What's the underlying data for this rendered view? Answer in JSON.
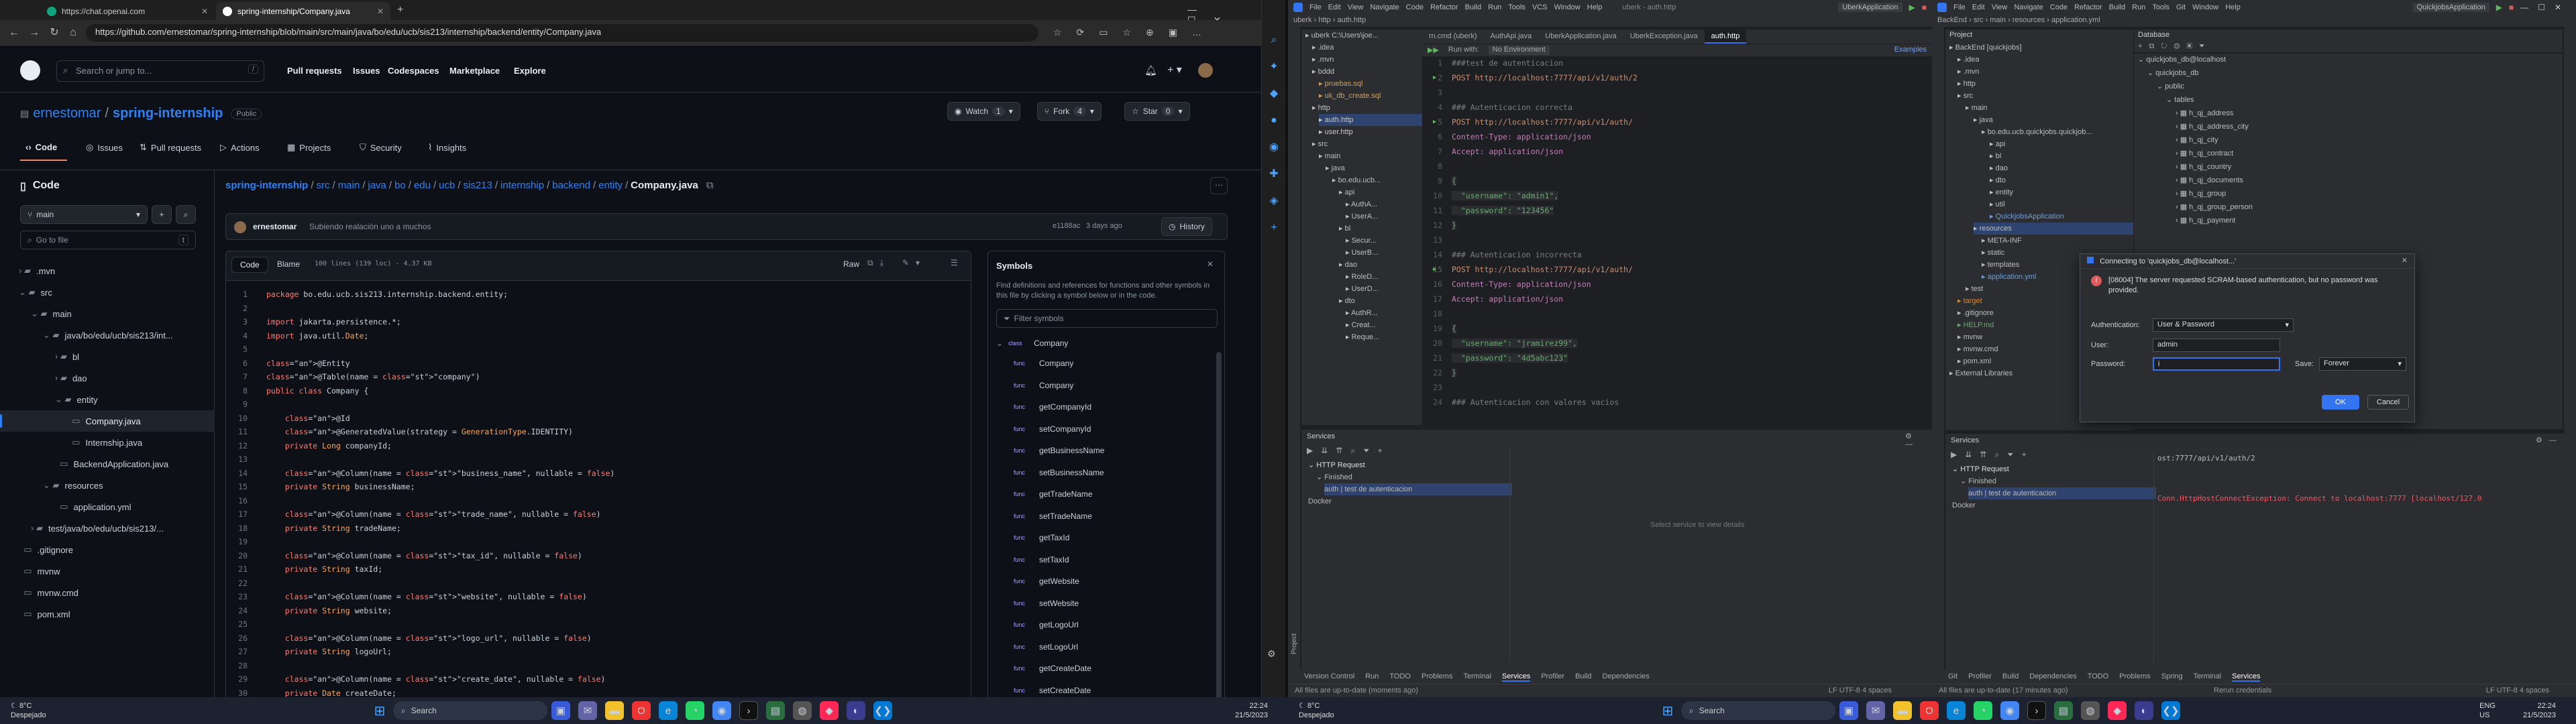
{
  "browser": {
    "tabs": [
      {
        "title": "https://chat.openai.com"
      },
      {
        "title": "spring-internship/Company.java"
      }
    ],
    "url": "https://github.com/ernestomar/spring-internship/blob/main/src/main/java/bo/edu/ucb/sis213/internship/backend/entity/Company.java"
  },
  "github": {
    "search_placeholder": "Search or jump to...",
    "search_key": "/",
    "nav": [
      "Pull requests",
      "Issues",
      "Codespaces",
      "Marketplace",
      "Explore"
    ],
    "owner": "ernestomar",
    "repo": "spring-internship",
    "visibility": "Public",
    "watch": {
      "label": "Watch",
      "count": "1"
    },
    "fork": {
      "label": "Fork",
      "count": "4"
    },
    "star": {
      "label": "Star",
      "count": "0"
    },
    "repo_tabs": [
      "Code",
      "Issues",
      "Pull requests",
      "Actions",
      "Projects",
      "Security",
      "Insights"
    ]
  },
  "tree": {
    "title": "Code",
    "branch": "main",
    "filter_placeholder": "Go to file",
    "filter_key": "t",
    "items": [
      {
        "label": ".mvn",
        "indent": 0,
        "type": "folder"
      },
      {
        "label": "src",
        "indent": 0,
        "type": "folder-open"
      },
      {
        "label": "main",
        "indent": 1,
        "type": "folder-open"
      },
      {
        "label": "java/bo/edu/ucb/sis213/int...",
        "indent": 2,
        "type": "folder-open"
      },
      {
        "label": "bl",
        "indent": 3,
        "type": "folder"
      },
      {
        "label": "dao",
        "indent": 3,
        "type": "folder"
      },
      {
        "label": "entity",
        "indent": 3,
        "type": "folder-open"
      },
      {
        "label": "Company.java",
        "indent": 4,
        "type": "file",
        "selected": true
      },
      {
        "label": "Internship.java",
        "indent": 4,
        "type": "file"
      },
      {
        "label": "BackendApplication.java",
        "indent": 3,
        "type": "file"
      },
      {
        "label": "resources",
        "indent": 2,
        "type": "folder-open"
      },
      {
        "label": "application.yml",
        "indent": 3,
        "type": "file"
      },
      {
        "label": "test/java/bo/edu/ucb/sis213/...",
        "indent": 1,
        "type": "folder"
      },
      {
        "label": ".gitignore",
        "indent": 0,
        "type": "file"
      },
      {
        "label": "mvnw",
        "indent": 0,
        "type": "file"
      },
      {
        "label": "mvnw.cmd",
        "indent": 0,
        "type": "file"
      },
      {
        "label": "pom.xml",
        "indent": 0,
        "type": "file"
      }
    ]
  },
  "breadcrumb": {
    "parts": [
      "spring-internship",
      "src",
      "main",
      "java",
      "bo",
      "edu",
      "ucb",
      "sis213",
      "internship",
      "backend",
      "entity"
    ],
    "file": "Company.java"
  },
  "commit": {
    "author": "ernestomar",
    "message": "Subiendo realación uno a muchos",
    "hash": "e1188ac",
    "time": "3 days ago",
    "history": "History"
  },
  "file_toolbar": {
    "code_tab": "Code",
    "blame_tab": "Blame",
    "stats": "100 lines (139 loc) · 4.37 KB",
    "raw": "Raw"
  },
  "code_lines": [
    "package bo.edu.ucb.sis213.internship.backend.entity;",
    "",
    "import jakarta.persistence.*;",
    "import java.util.Date;",
    "",
    "@Entity",
    "@Table(name = \"company\")",
    "public class Company {",
    "",
    "    @Id",
    "    @GeneratedValue(strategy = GenerationType.IDENTITY)",
    "    private Long companyId;",
    "",
    "    @Column(name = \"business_name\", nullable = false)",
    "    private String businessName;",
    "",
    "    @Column(name = \"trade_name\", nullable = false)",
    "    private String tradeName;",
    "",
    "    @Column(name = \"tax_id\", nullable = false)",
    "    private String taxId;",
    "",
    "    @Column(name = \"website\", nullable = false)",
    "    private String website;",
    "",
    "    @Column(name = \"logo_url\", nullable = false)",
    "    private String logoUrl;",
    "",
    "    @Column(name = \"create_date\", nullable = false)",
    "    private Date createDate;"
  ],
  "symbols": {
    "title": "Symbols",
    "description": "Find definitions and references for functions and other symbols in this file by clicking a symbol below or in the code.",
    "filter_placeholder": "Filter symbols",
    "class_badge": "class",
    "func_badge": "func",
    "root": "Company",
    "items": [
      "Company",
      "Company",
      "getCompanyId",
      "setCompanyId",
      "getBusinessName",
      "setBusinessName",
      "getTradeName",
      "setTradeName",
      "getTaxId",
      "setTaxId",
      "getWebsite",
      "setWebsite",
      "getLogoUrl",
      "setLogoUrl",
      "getCreateDate",
      "setCreateDate"
    ]
  },
  "ide1": {
    "title": "uberk - auth.http",
    "menu": [
      "File",
      "Edit",
      "View",
      "Navigate",
      "Code",
      "Refactor",
      "Build",
      "Run",
      "Tools",
      "VCS",
      "Window",
      "Help"
    ],
    "run_config": "UberkApplication",
    "breadcrumb": [
      "uberk",
      "http",
      "auth.http"
    ],
    "editor_tabs": [
      "rn.cmd (uberk)",
      "AuthApi.java",
      "UberkApplication.java",
      "UberkException.java",
      "auth.http"
    ],
    "run_with": "Run with:",
    "env": "No Environment",
    "examples": "Examples",
    "project_label": "Project",
    "project_tree": [
      "uberk C:\\Users\\joe...",
      ".idea",
      ".mvn",
      "bddd",
      "pruebas.sql",
      "uk_db_create.sql",
      "http",
      "auth.http",
      "user.http",
      "src",
      "main",
      "java",
      "bo.edu.ucb...",
      "api",
      "AuthA...",
      "UserA...",
      "bl",
      "Secur...",
      "UserB...",
      "dao",
      "RoleD...",
      "UserD...",
      "dto",
      "AuthR...",
      "Creat...",
      "Reque..."
    ],
    "editor_lines": [
      {
        "t": "###test de autenticacion",
        "c": "cm"
      },
      {
        "t": "POST http://localhost:7777/api/v1/auth/2",
        "c": "req"
      },
      {
        "t": "",
        "c": ""
      },
      {
        "t": "### Autenticacion correcta",
        "c": "cm"
      },
      {
        "t": "POST http://localhost:7777/api/v1/auth/",
        "c": "req"
      },
      {
        "t": "Content-Type: application/json",
        "c": "hd"
      },
      {
        "t": "Accept: application/json",
        "c": "hd"
      },
      {
        "t": "",
        "c": ""
      },
      {
        "t": "{",
        "c": "js"
      },
      {
        "t": "  \"username\": \"admin1\",",
        "c": "js"
      },
      {
        "t": "  \"password\": \"123456\"",
        "c": "js"
      },
      {
        "t": "}",
        "c": "js"
      },
      {
        "t": "",
        "c": ""
      },
      {
        "t": "### Autenticacion incorrecta",
        "c": "cm"
      },
      {
        "t": "POST http://localhost:7777/api/v1/auth/",
        "c": "req"
      },
      {
        "t": "Content-Type: application/json",
        "c": "hd"
      },
      {
        "t": "Accept: application/json",
        "c": "hd"
      },
      {
        "t": "",
        "c": ""
      },
      {
        "t": "{",
        "c": "js"
      },
      {
        "t": "  \"username\": \"jramirez99\",",
        "c": "js"
      },
      {
        "t": "  \"password\": \"4d5abc123\"",
        "c": "js"
      },
      {
        "t": "}",
        "c": "js"
      },
      {
        "t": "",
        "c": ""
      },
      {
        "t": "### Autenticacion con valores vacios",
        "c": "cm"
      }
    ],
    "services_title": "Services",
    "services_tree": [
      "HTTP Request",
      "Finished",
      "auth | test de autenticacion",
      "Docker"
    ],
    "services_hint": "Select service to view details",
    "bottom_tabs": [
      "Version Control",
      "Run",
      "TODO",
      "Problems",
      "Terminal",
      "Services",
      "Profiler",
      "Build",
      "Dependencies"
    ],
    "status": "All files are up-to-date (moments ago)",
    "status_right": "LF  UTF-8  4 spaces"
  },
  "ide2": {
    "title": "BackEnd - application.yml",
    "menu": [
      "File",
      "Edit",
      "View",
      "Navigate",
      "Code",
      "Refactor",
      "Build",
      "Run",
      "Tools",
      "Git",
      "Window",
      "Help"
    ],
    "run_config": "QuickjobsApplication",
    "breadcrumb": [
      "BackEnd",
      "src",
      "main",
      "resources",
      "application.yml"
    ],
    "project_label": "Project",
    "project_tree": [
      "BackEnd [quickjobs]",
      ".idea",
      ".mvn",
      "http",
      "src",
      "main",
      "java",
      "bo.edu.ucb.quickjobs.quickjob...",
      "api",
      "bl",
      "dao",
      "dto",
      "entity",
      "util",
      "QuickjobsApplication",
      "resources",
      "META-INF",
      "static",
      "templates",
      "application.yml",
      "test",
      "target",
      ".gitignore",
      "HELP.md",
      "mvnw",
      "mvnw.cmd",
      "pom.xml",
      "External Libraries"
    ],
    "db_title": "Database",
    "db_tree": [
      "quickjobs_db@localhost",
      "quickjobs_db",
      "public",
      "tables",
      "h_qj_address",
      "h_qj_address_city",
      "h_qj_city",
      "h_qj_contract",
      "h_qj_country",
      "h_qj_documents",
      "h_qj_group",
      "h_qj_group_person",
      "h_qj_payment"
    ],
    "services_title": "Services",
    "services_tree": [
      "HTTP Request",
      "Finished",
      "auth | test de autenticacion",
      "Docker"
    ],
    "console_url": "ost:7777/api/v1/auth/2",
    "console_error": "Conn.HttpHostConnectException: Connect to localhost:7777 [localhost/127.0",
    "bottom_tabs": [
      "Git",
      "Profiler",
      "Build",
      "Dependencies",
      "TODO",
      "Problems",
      "Spring",
      "Terminal",
      "Services"
    ],
    "status": "All files are up-to-date (17 minutes ago)",
    "status_right": "LF  UTF-8  4 spaces",
    "auth_label": "Rerun credentials"
  },
  "dialog": {
    "title": "Connecting to 'quickjobs_db@localhost...'",
    "message": "[08004] The server requested SCRAM-based authentication, but no password was provided.",
    "auth_label": "Authentication:",
    "auth_value": "User & Password",
    "user_label": "User:",
    "user_value": "admin",
    "password_label": "Password:",
    "password_value": "i",
    "save_label": "Save:",
    "save_value": "Forever",
    "ok": "OK",
    "cancel": "Cancel"
  },
  "taskbar_left": {
    "temp": "8°C",
    "weather": "Despejado",
    "search": "Search",
    "time": "22:24",
    "date": "21/5/2023"
  },
  "taskbar_right": {
    "temp": "8°C",
    "weather": "Despejado",
    "search": "Search",
    "lang": "ENG",
    "region": "US",
    "time": "22:24",
    "date": "21/5/2023"
  },
  "colors": {
    "accent": "#2f81f7",
    "gh_bg": "#0d1117",
    "ide_bg": "#1e1f22",
    "error": "#f75464"
  }
}
